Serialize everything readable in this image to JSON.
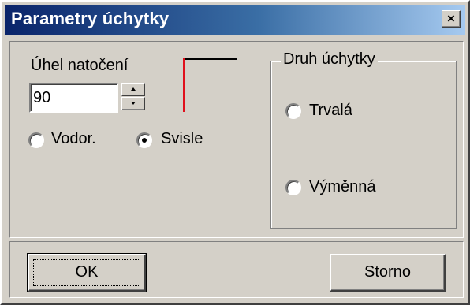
{
  "window": {
    "title": "Parametry úchytky",
    "close_label": "×"
  },
  "angle": {
    "label": "Úhel natočení",
    "value": "90"
  },
  "orientation": {
    "options": [
      {
        "label": "Vodor.",
        "checked": false
      },
      {
        "label": "Svisle",
        "checked": true
      }
    ]
  },
  "handle_type": {
    "label": "Druh úchytky",
    "options": [
      {
        "label": "Trvalá",
        "checked": false
      },
      {
        "label": "Výměnná",
        "checked": false
      }
    ]
  },
  "preview": {
    "line_color": "#e0101c"
  },
  "buttons": {
    "ok_label": "OK",
    "cancel_label": "Storno"
  }
}
